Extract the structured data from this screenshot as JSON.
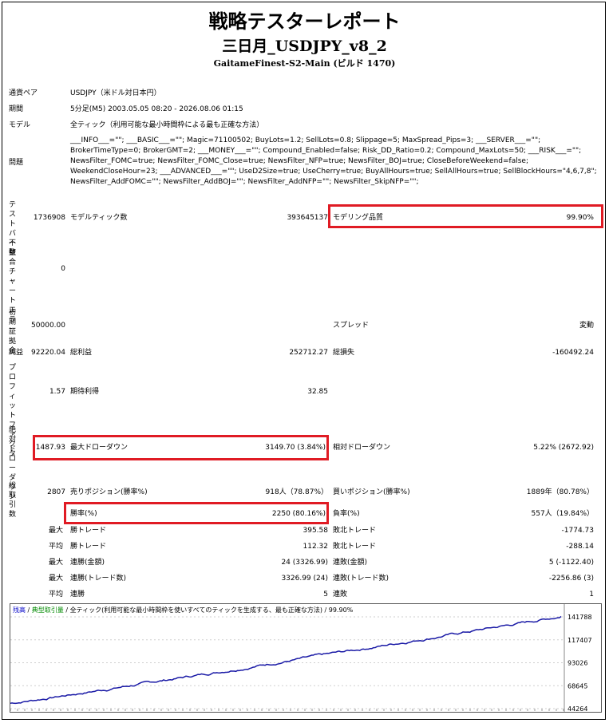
{
  "title": "戦略テスターレポート",
  "ea_name": "三日月_USDJPY_v8_2",
  "server_build": "GaitameFinest-S2-Main (ビルド 1470)",
  "info": {
    "symbol_label": "通貨ペア",
    "symbol_value": "USDJPY（米ドル対日本円）",
    "period_label": "期間",
    "period_value": "5分足(M5) 2003.05.05 08:20 - 2026.08.06 01:15",
    "model_label": "モデル",
    "model_value": "全ティック（利用可能な最小時間枠による最も正確な方法）",
    "params_label": "問題",
    "params_value": "___INFO___=\"\"; ___BASIC___=\"\"; Magic=71100502; BuyLots=1.2; SellLots=0.8; Slippage=5; MaxSpread_Pips=3; ___SERVER___=\"\"; BrokerTimeType=0; BrokerGMT=2; ___MONEY___=\"\"; Compound_Enabled=false; Risk_DD_Ratio=0.2; Compound_MaxLots=50; ___RISK___=\"\"; NewsFilter_FOMC=true; NewsFilter_FOMC_Close=true; NewsFilter_NFP=true; NewsFilter_BOJ=true; CloseBeforeWeekend=false; WeekendCloseHour=23; ___ADVANCED___=\"\"; UseD2Size=true; UseCherry=true; BuyAllHours=true; SellAllHours=true; SellBlockHours=\"4,6,7,8\"; NewsFilter_AddFOMC=\"\"; NewsFilter_AddBOJ=\"\"; NewsFilter_AddNFP=\"\"; NewsFilter_SkipNFP=\"\";"
  },
  "stats": {
    "bars_label": "テストバー数",
    "bars_value": "1736908",
    "ticks_label": "モデルティック数",
    "ticks_value": "393645137",
    "quality_label": "モデリング品質",
    "quality_value": "99.90%",
    "mismatch_label": "不整合チャートエラー",
    "mismatch_value": "0",
    "deposit_label": "初期証拠金",
    "deposit_value": "50000.00",
    "spread_label": "スプレッド",
    "spread_value": "変動",
    "net_label": "純益",
    "net_value": "92220.04",
    "gross_profit_label": "総利益",
    "gross_profit_value": "252712.27",
    "gross_loss_label": "総損失",
    "gross_loss_value": "-160492.24",
    "pf_label": "プロフィットファクタ",
    "pf_value": "1.57",
    "expected_label": "期待利得",
    "expected_value": "32.85",
    "abs_dd_label": "絶対ドローダウン",
    "abs_dd_value": "1487.93",
    "max_dd_label": "最大ドローダウン",
    "max_dd_value": "3149.70 (3.84%)",
    "rel_dd_label": "相対ドローダウン",
    "rel_dd_value": "5.22% (2672.92)",
    "trades_label": "総取引数",
    "trades_value": "2807",
    "short_label": "売りポジション(勝率%)",
    "short_value": "918人（78.87%）",
    "long_label": "買いポジション(勝率%)",
    "long_value": "1889年（80.78%）",
    "win_label": "勝率(%)",
    "win_value": "2250 (80.16%)",
    "loss_label": "負率(%)",
    "loss_value": "557人（19.84%）"
  },
  "details": [
    {
      "prefix": "最大",
      "l1": "勝トレード",
      "v1": "395.58",
      "l2": "敗北トレード",
      "v2": "-1774.73"
    },
    {
      "prefix": "平均",
      "l1": "勝トレード",
      "v1": "112.32",
      "l2": "敗北トレード",
      "v2": "-288.14"
    },
    {
      "prefix": "最大",
      "l1": "連勝(金額)",
      "v1": "24 (3326.99)",
      "l2": "連敗(金額)",
      "v2": "5 (-1122.40)"
    },
    {
      "prefix": "最大",
      "l1": "連勝(トレード数)",
      "v1": "3326.99 (24)",
      "l2": "連敗(トレード数)",
      "v2": "-2256.86 (3)"
    },
    {
      "prefix": "平均",
      "l1": "連勝",
      "v1": "5",
      "l2": "連敗",
      "v2": "1"
    }
  ],
  "chart_data": {
    "type": "line",
    "legend": {
      "balance": "残高",
      "sep1": " / ",
      "lots": "典型取引量",
      "sep2": " / ",
      "desc": "全ティック(利用可能な最小時間枠を使いすべてのティックを生成する、最も正確な方法)",
      "sep3": " / ",
      "quality": "99.90%"
    },
    "yticks": [
      "141788",
      "117407",
      "93026",
      "68645",
      "44264"
    ],
    "ylim": [
      44264,
      141788
    ],
    "balance_start": 50000,
    "balance_end": 142220.04,
    "line_color": "#1a1aa6"
  }
}
